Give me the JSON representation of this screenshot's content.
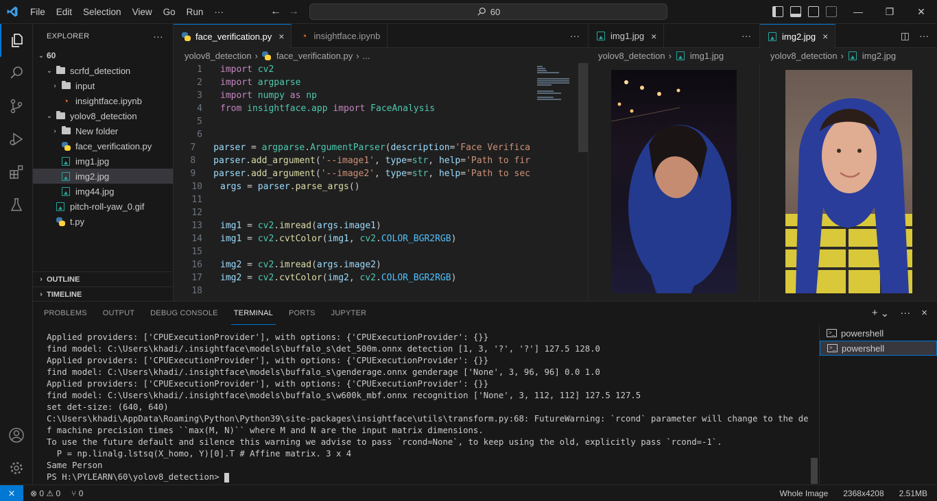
{
  "titlebar": {
    "menu": [
      "File",
      "Edit",
      "Selection",
      "View",
      "Go",
      "Run",
      "···"
    ],
    "search": "60"
  },
  "explorer": {
    "title": "EXPLORER",
    "more": "···",
    "root": "60",
    "items": [
      {
        "label": "scrfd_detection",
        "type": "folder",
        "open": true
      },
      {
        "label": "input",
        "type": "folder",
        "open": false
      },
      {
        "label": "insightface.ipynb",
        "type": "notebook"
      },
      {
        "label": "yolov8_detection",
        "type": "folder",
        "open": true
      },
      {
        "label": "New folder",
        "type": "folder",
        "open": false
      },
      {
        "label": "face_verification.py",
        "type": "python"
      },
      {
        "label": "img1.jpg",
        "type": "image"
      },
      {
        "label": "img2.jpg",
        "type": "image",
        "selected": true
      },
      {
        "label": "img44.jpg",
        "type": "image"
      },
      {
        "label": "pitch-roll-yaw_0.gif",
        "type": "image"
      },
      {
        "label": "t.py",
        "type": "python"
      }
    ],
    "outline": "OUTLINE",
    "timeline": "TIMELINE"
  },
  "editor": {
    "tabs": [
      {
        "label": "face_verification.py",
        "close": "×"
      },
      {
        "label": "insightface.ipynb"
      }
    ],
    "more": "···",
    "breadcrumb": [
      "yolov8_detection",
      "face_verification.py",
      "..."
    ],
    "lines": [
      {
        "n": "1",
        "tokens": [
          [
            "kw",
            "import"
          ],
          [
            "",
            " "
          ],
          [
            "mod",
            "cv2"
          ]
        ]
      },
      {
        "n": "2",
        "tokens": [
          [
            "kw",
            "import"
          ],
          [
            "",
            " "
          ],
          [
            "mod",
            "argparse"
          ]
        ]
      },
      {
        "n": "3",
        "tokens": [
          [
            "kw",
            "import"
          ],
          [
            "",
            " "
          ],
          [
            "mod",
            "numpy"
          ],
          [
            "",
            " "
          ],
          [
            "kw",
            "as"
          ],
          [
            "",
            " "
          ],
          [
            "mod",
            "np"
          ]
        ]
      },
      {
        "n": "4",
        "tokens": [
          [
            "kw",
            "from"
          ],
          [
            "",
            " "
          ],
          [
            "mod",
            "insightface.app"
          ],
          [
            "",
            " "
          ],
          [
            "kw",
            "import"
          ],
          [
            "",
            " "
          ],
          [
            "cls",
            "FaceAnalysis"
          ]
        ]
      },
      {
        "n": "5",
        "tokens": []
      },
      {
        "n": "6",
        "tokens": []
      },
      {
        "n": "7",
        "tokens": [
          [
            "var",
            "parser"
          ],
          [
            "",
            " = "
          ],
          [
            "mod",
            "argparse"
          ],
          [
            "",
            "."
          ],
          [
            "cls",
            "ArgumentParser"
          ],
          [
            "",
            "("
          ],
          [
            "var",
            "description"
          ],
          [
            "",
            "="
          ],
          [
            "str",
            "'Face Verifica"
          ]
        ]
      },
      {
        "n": "8",
        "tokens": [
          [
            "var",
            "parser"
          ],
          [
            "",
            "."
          ],
          [
            "fn",
            "add_argument"
          ],
          [
            "",
            "("
          ],
          [
            "str",
            "'--image1'"
          ],
          [
            "",
            ", "
          ],
          [
            "var",
            "type"
          ],
          [
            "",
            "="
          ],
          [
            "cls",
            "str"
          ],
          [
            "",
            ", "
          ],
          [
            "var",
            "help"
          ],
          [
            "",
            "="
          ],
          [
            "str",
            "'Path to fir"
          ]
        ]
      },
      {
        "n": "9",
        "tokens": [
          [
            "var",
            "parser"
          ],
          [
            "",
            "."
          ],
          [
            "fn",
            "add_argument"
          ],
          [
            "",
            "("
          ],
          [
            "str",
            "'--image2'"
          ],
          [
            "",
            ", "
          ],
          [
            "var",
            "type"
          ],
          [
            "",
            "="
          ],
          [
            "cls",
            "str"
          ],
          [
            "",
            ", "
          ],
          [
            "var",
            "help"
          ],
          [
            "",
            "="
          ],
          [
            "str",
            "'Path to sec"
          ]
        ]
      },
      {
        "n": "10",
        "tokens": [
          [
            "var",
            "args"
          ],
          [
            "",
            " = "
          ],
          [
            "var",
            "parser"
          ],
          [
            "",
            "."
          ],
          [
            "fn",
            "parse_args"
          ],
          [
            "",
            "()"
          ]
        ]
      },
      {
        "n": "11",
        "tokens": []
      },
      {
        "n": "12",
        "tokens": []
      },
      {
        "n": "13",
        "tokens": [
          [
            "var",
            "img1"
          ],
          [
            "",
            " = "
          ],
          [
            "mod",
            "cv2"
          ],
          [
            "",
            "."
          ],
          [
            "fn",
            "imread"
          ],
          [
            "",
            "("
          ],
          [
            "var",
            "args"
          ],
          [
            "",
            "."
          ],
          [
            "var",
            "image1"
          ],
          [
            "",
            ")"
          ]
        ]
      },
      {
        "n": "14",
        "tokens": [
          [
            "var",
            "img1"
          ],
          [
            "",
            " = "
          ],
          [
            "mod",
            "cv2"
          ],
          [
            "",
            "."
          ],
          [
            "fn",
            "cvtColor"
          ],
          [
            "",
            "("
          ],
          [
            "var",
            "img1"
          ],
          [
            "",
            ", "
          ],
          [
            "mod",
            "cv2"
          ],
          [
            "",
            "."
          ],
          [
            "const",
            "COLOR_BGR2RGB"
          ],
          [
            "",
            ")"
          ]
        ]
      },
      {
        "n": "15",
        "tokens": []
      },
      {
        "n": "16",
        "tokens": [
          [
            "var",
            "img2"
          ],
          [
            "",
            " = "
          ],
          [
            "mod",
            "cv2"
          ],
          [
            "",
            "."
          ],
          [
            "fn",
            "imread"
          ],
          [
            "",
            "("
          ],
          [
            "var",
            "args"
          ],
          [
            "",
            "."
          ],
          [
            "var",
            "image2"
          ],
          [
            "",
            ")"
          ]
        ]
      },
      {
        "n": "17",
        "tokens": [
          [
            "var",
            "img2"
          ],
          [
            "",
            " = "
          ],
          [
            "mod",
            "cv2"
          ],
          [
            "",
            "."
          ],
          [
            "fn",
            "cvtColor"
          ],
          [
            "",
            "("
          ],
          [
            "var",
            "img2"
          ],
          [
            "",
            ", "
          ],
          [
            "mod",
            "cv2"
          ],
          [
            "",
            "."
          ],
          [
            "const",
            "COLOR_BGR2RGB"
          ],
          [
            "",
            ")"
          ]
        ]
      },
      {
        "n": "18",
        "tokens": []
      }
    ]
  },
  "image_group_1": {
    "tab": "img1.jpg",
    "close": "×",
    "more": "···",
    "breadcrumb": [
      "yolov8_detection",
      "img1.jpg"
    ]
  },
  "image_group_2": {
    "tab": "img2.jpg",
    "close": "×",
    "more": "···",
    "breadcrumb": [
      "yolov8_detection",
      "img2.jpg"
    ]
  },
  "panel": {
    "tabs": [
      "PROBLEMS",
      "OUTPUT",
      "DEBUG CONSOLE",
      "TERMINAL",
      "PORTS",
      "JUPYTER"
    ],
    "active_tab": "TERMINAL",
    "actions": [
      "+",
      "⌄",
      "···",
      "×"
    ],
    "terminal_lines": [
      "Applied providers: ['CPUExecutionProvider'], with options: {'CPUExecutionProvider': {}}",
      "find model: C:\\Users\\khadi/.insightface\\models\\buffalo_s\\det_500m.onnx detection [1, 3, '?', '?'] 127.5 128.0",
      "Applied providers: ['CPUExecutionProvider'], with options: {'CPUExecutionProvider': {}}",
      "find model: C:\\Users\\khadi/.insightface\\models\\buffalo_s\\genderage.onnx genderage ['None', 3, 96, 96] 0.0 1.0",
      "Applied providers: ['CPUExecutionProvider'], with options: {'CPUExecutionProvider': {}}",
      "find model: C:\\Users\\khadi/.insightface\\models\\buffalo_s\\w600k_mbf.onnx recognition ['None', 3, 112, 112] 127.5 127.5",
      "set det-size: (640, 640)",
      "C:\\Users\\khadi\\AppData\\Roaming\\Python\\Python39\\site-packages\\insightface\\utils\\transform.py:68: FutureWarning: `rcond` parameter will change to the default o",
      "f machine precision times ``max(M, N)`` where M and N are the input matrix dimensions.",
      "To use the future default and silence this warning we advise to pass `rcond=None`, to keep using the old, explicitly pass `rcond=-1`.",
      "  P = np.linalg.lstsq(X_homo, Y)[0].T # Affine matrix. 3 x 4",
      "Same Person",
      "PS H:\\PYLEARN\\60\\yolov8_detection> "
    ],
    "terminals": [
      "powershell",
      "powershell"
    ]
  },
  "statusbar": {
    "remote": "⨯",
    "problems": "⊗ 0 ⚠ 0",
    "ports": "⑂ 0",
    "right": [
      "Whole Image",
      "2368x4208",
      "2.51MB"
    ]
  },
  "colors": {
    "accent": "#0078d4",
    "background": "#1f1f1f",
    "chrome": "#181818"
  }
}
